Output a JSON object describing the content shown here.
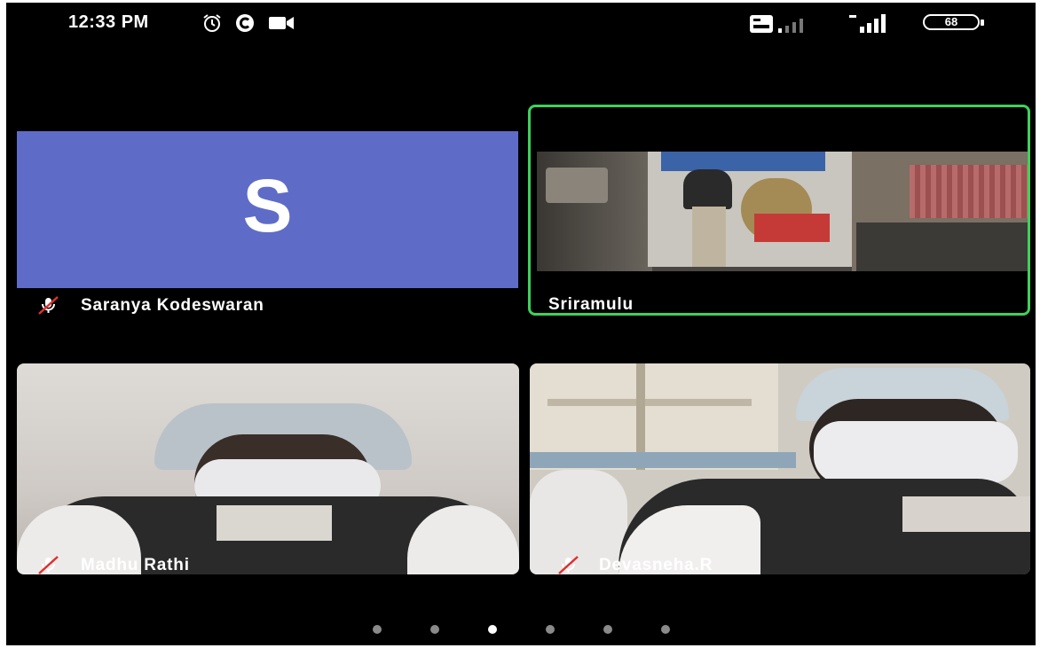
{
  "status_bar": {
    "time": "12:33 PM",
    "battery": "68",
    "icons": [
      "alarm-icon",
      "c-badge-icon",
      "video-camera-icon",
      "volte-icon",
      "signal-icon",
      "signal-icon",
      "battery-icon"
    ]
  },
  "participants": [
    {
      "name": "Saranya Kodeswaran",
      "avatar_letter": "S",
      "muted": true,
      "video": false,
      "active_speaker": false,
      "avatar_color": "#5e6cc8"
    },
    {
      "name": "Sriramulu",
      "muted": false,
      "video": true,
      "active_speaker": true
    },
    {
      "name": "Madhu Rathi",
      "muted": true,
      "video": true,
      "active_speaker": false
    },
    {
      "name": "Devasneha.R",
      "muted": true,
      "video": true,
      "active_speaker": false
    }
  ],
  "pagination": {
    "pages": 6,
    "current": 3
  },
  "colors": {
    "active_border": "#3fd15a",
    "mute_red": "#e03030",
    "avatar_bg": "#5e6cc8"
  }
}
